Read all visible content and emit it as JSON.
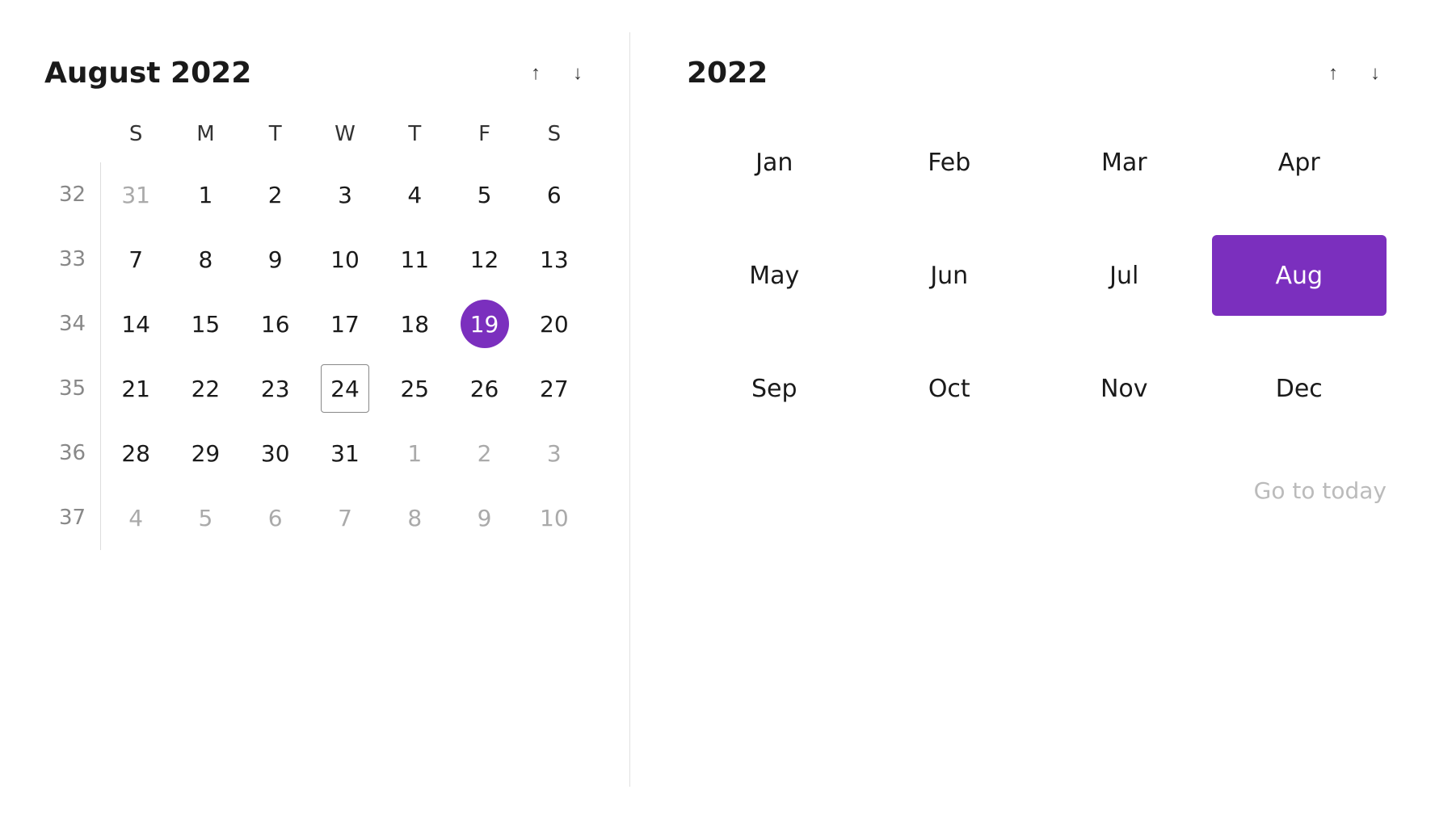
{
  "left": {
    "title": "August 2022",
    "nav_up_label": "↑",
    "nav_down_label": "↓",
    "day_headers": [
      "S",
      "M",
      "T",
      "W",
      "T",
      "F",
      "S"
    ],
    "weeks": [
      {
        "week_num": "32",
        "days": [
          {
            "date": "31",
            "type": "other-month"
          },
          {
            "date": "1",
            "type": "normal"
          },
          {
            "date": "2",
            "type": "normal"
          },
          {
            "date": "3",
            "type": "normal"
          },
          {
            "date": "4",
            "type": "normal"
          },
          {
            "date": "5",
            "type": "normal"
          },
          {
            "date": "6",
            "type": "normal"
          }
        ]
      },
      {
        "week_num": "33",
        "days": [
          {
            "date": "7",
            "type": "normal"
          },
          {
            "date": "8",
            "type": "normal"
          },
          {
            "date": "9",
            "type": "normal"
          },
          {
            "date": "10",
            "type": "normal"
          },
          {
            "date": "11",
            "type": "normal"
          },
          {
            "date": "12",
            "type": "normal"
          },
          {
            "date": "13",
            "type": "normal"
          }
        ]
      },
      {
        "week_num": "34",
        "days": [
          {
            "date": "14",
            "type": "normal"
          },
          {
            "date": "15",
            "type": "normal"
          },
          {
            "date": "16",
            "type": "normal"
          },
          {
            "date": "17",
            "type": "normal"
          },
          {
            "date": "18",
            "type": "normal"
          },
          {
            "date": "19",
            "type": "today"
          },
          {
            "date": "20",
            "type": "normal"
          }
        ]
      },
      {
        "week_num": "35",
        "days": [
          {
            "date": "21",
            "type": "normal"
          },
          {
            "date": "22",
            "type": "normal"
          },
          {
            "date": "23",
            "type": "normal"
          },
          {
            "date": "24",
            "type": "selected"
          },
          {
            "date": "25",
            "type": "normal"
          },
          {
            "date": "26",
            "type": "normal"
          },
          {
            "date": "27",
            "type": "normal"
          }
        ]
      },
      {
        "week_num": "36",
        "days": [
          {
            "date": "28",
            "type": "normal"
          },
          {
            "date": "29",
            "type": "normal"
          },
          {
            "date": "30",
            "type": "normal"
          },
          {
            "date": "31",
            "type": "normal"
          },
          {
            "date": "1",
            "type": "other-month"
          },
          {
            "date": "2",
            "type": "other-month"
          },
          {
            "date": "3",
            "type": "other-month"
          }
        ]
      },
      {
        "week_num": "37",
        "days": [
          {
            "date": "4",
            "type": "other-month"
          },
          {
            "date": "5",
            "type": "other-month"
          },
          {
            "date": "6",
            "type": "other-month"
          },
          {
            "date": "7",
            "type": "other-month"
          },
          {
            "date": "8",
            "type": "other-month"
          },
          {
            "date": "9",
            "type": "other-month"
          },
          {
            "date": "10",
            "type": "other-month"
          }
        ]
      }
    ]
  },
  "right": {
    "title": "2022",
    "nav_up_label": "↑",
    "nav_down_label": "↓",
    "months": [
      {
        "label": "Jan",
        "selected": false
      },
      {
        "label": "Feb",
        "selected": false
      },
      {
        "label": "Mar",
        "selected": false
      },
      {
        "label": "Apr",
        "selected": false
      },
      {
        "label": "May",
        "selected": false
      },
      {
        "label": "Jun",
        "selected": false
      },
      {
        "label": "Jul",
        "selected": false
      },
      {
        "label": "Aug",
        "selected": true
      },
      {
        "label": "Sep",
        "selected": false
      },
      {
        "label": "Oct",
        "selected": false
      },
      {
        "label": "Nov",
        "selected": false
      },
      {
        "label": "Dec",
        "selected": false
      }
    ],
    "go_to_today": "Go to today"
  }
}
